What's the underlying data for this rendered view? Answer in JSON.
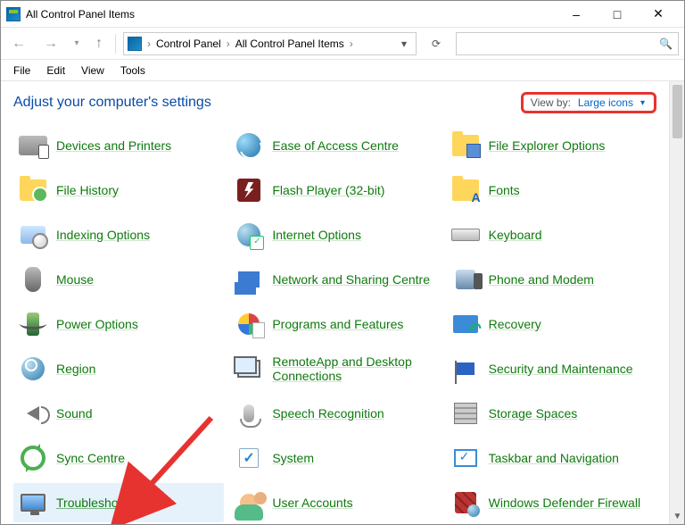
{
  "window": {
    "title": "All Control Panel Items"
  },
  "nav": {
    "crumbs": [
      "Control Panel",
      "All Control Panel Items"
    ]
  },
  "menu": {
    "file": "File",
    "edit": "Edit",
    "view": "View",
    "tools": "Tools"
  },
  "header": {
    "page_title": "Adjust your computer's settings",
    "view_by_label": "View by:",
    "view_by_value": "Large icons"
  },
  "items": {
    "col1": [
      {
        "id": "devices-and-printers",
        "label": "Devices and Printers",
        "icon": "ic-devices"
      },
      {
        "id": "file-history",
        "label": "File History",
        "icon": "ic-folder ic-clock-badge"
      },
      {
        "id": "indexing-options",
        "label": "Indexing Options",
        "icon": "ic-index"
      },
      {
        "id": "mouse",
        "label": "Mouse",
        "icon": "ic-mouse"
      },
      {
        "id": "power-options",
        "label": "Power Options",
        "icon": "ic-power"
      },
      {
        "id": "region",
        "label": "Region",
        "icon": "ic-globe clock"
      },
      {
        "id": "sound",
        "label": "Sound",
        "icon": "ic-speaker"
      },
      {
        "id": "sync-centre",
        "label": "Sync Centre",
        "icon": "ic-sync"
      },
      {
        "id": "troubleshooting",
        "label": "Troubleshooting",
        "icon": "ic-monitor",
        "selected": true
      }
    ],
    "col2": [
      {
        "id": "ease-of-access-centre",
        "label": "Ease of Access Centre",
        "icon": "ic-ease"
      },
      {
        "id": "flash-player",
        "label": "Flash Player (32-bit)",
        "icon": "ic-flash"
      },
      {
        "id": "internet-options",
        "label": "Internet Options",
        "icon": "ic-netopt"
      },
      {
        "id": "network-sharing",
        "label": "Network and Sharing Centre",
        "icon": "ic-netshare"
      },
      {
        "id": "programs-features",
        "label": "Programs and Features",
        "icon": "ic-programs"
      },
      {
        "id": "remoteapp",
        "label": "RemoteApp and Desktop Connections",
        "icon": "ic-remote"
      },
      {
        "id": "speech",
        "label": "Speech Recognition",
        "icon": "ic-mic"
      },
      {
        "id": "system",
        "label": "System",
        "icon": "ic-check"
      },
      {
        "id": "user-accounts",
        "label": "User Accounts",
        "icon": "ic-users"
      }
    ],
    "col3": [
      {
        "id": "file-explorer-options",
        "label": "File Explorer Options",
        "icon": "ic-folder-blue"
      },
      {
        "id": "fonts",
        "label": "Fonts",
        "icon": "ic-font"
      },
      {
        "id": "keyboard",
        "label": "Keyboard",
        "icon": "ic-keyboard"
      },
      {
        "id": "phone-modem",
        "label": "Phone and Modem",
        "icon": "ic-phone"
      },
      {
        "id": "recovery",
        "label": "Recovery",
        "icon": "ic-recovery"
      },
      {
        "id": "security-maintenance",
        "label": "Security and Maintenance",
        "icon": "ic-flag"
      },
      {
        "id": "storage-spaces",
        "label": "Storage Spaces",
        "icon": "ic-storage"
      },
      {
        "id": "taskbar-nav",
        "label": "Taskbar and Navigation",
        "icon": "ic-taskbar"
      },
      {
        "id": "defender-firewall",
        "label": "Windows Defender Firewall",
        "icon": "ic-firewall"
      }
    ]
  }
}
